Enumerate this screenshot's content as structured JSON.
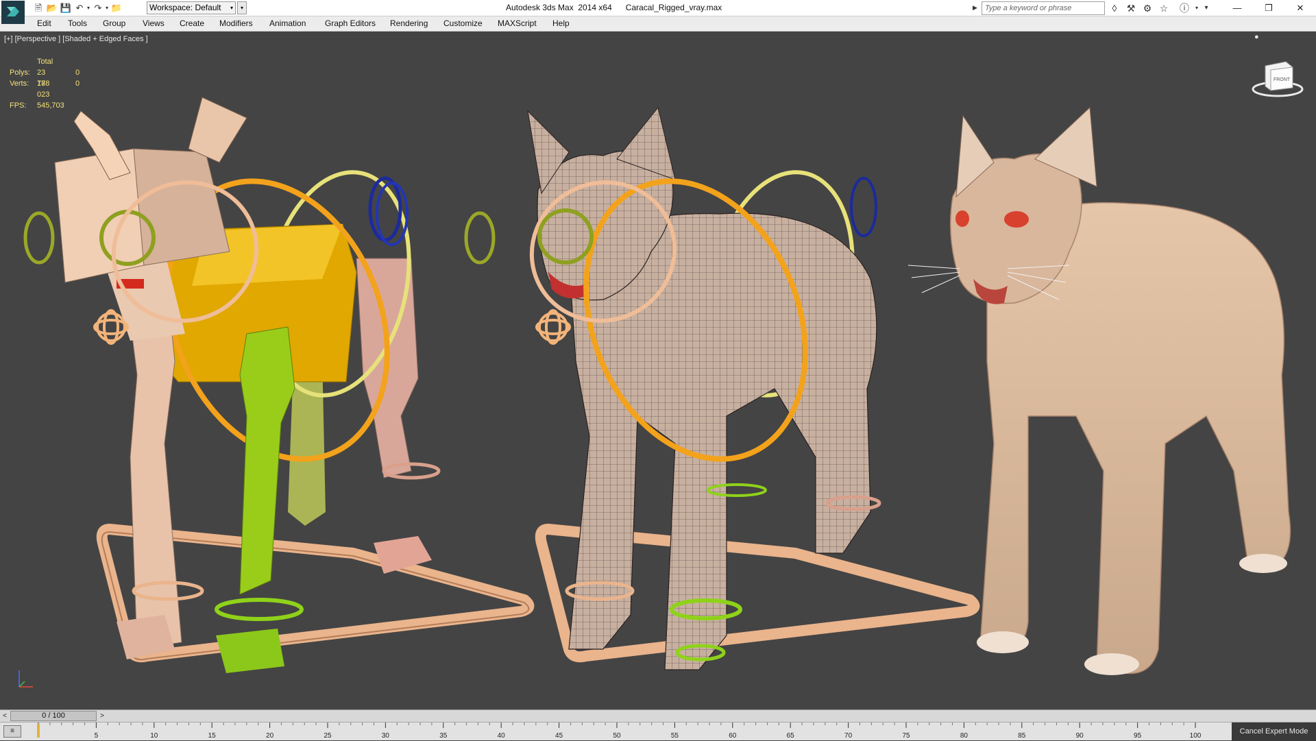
{
  "titlebar": {
    "workspace_label": "Workspace: Default",
    "app_title": "Autodesk 3ds Max  2014 x64",
    "file_name": "Caracal_Rigged_vray.max",
    "search_placeholder": "Type a keyword or phrase",
    "quick_access_icons": [
      "new-file-icon",
      "open-folder-icon",
      "save-icon",
      "undo-icon",
      "redo-icon",
      "project-folder-icon"
    ],
    "toolbar_icons": [
      "binoculars-icon",
      "tools-icon",
      "star-icon",
      "help-icon"
    ],
    "window_controls": [
      "minimize-icon",
      "restore-icon",
      "close-icon"
    ]
  },
  "menu": {
    "items": [
      "Edit",
      "Tools",
      "Group",
      "Views",
      "Create",
      "Modifiers",
      "Animation",
      "Graph Editors",
      "Rendering",
      "Customize",
      "MAXScript",
      "Help"
    ]
  },
  "viewport": {
    "label": "[+] [Perspective ] [Shaded + Edged Faces ]",
    "stats": {
      "header": "Total",
      "polys_label": "Polys:",
      "polys_value": "23 788",
      "polys_selected": "0",
      "verts_label": "Verts:",
      "verts_value": "17 023",
      "verts_selected": "0",
      "fps_label": "FPS:",
      "fps_value": "545,703"
    },
    "viewcube_label": "FRONT",
    "colors": {
      "background": "#444444",
      "rig_yellow": "#e0a800",
      "rig_green": "#9acd1a",
      "rig_olive": "#8fa020",
      "rig_blue": "#1c2a9c",
      "rig_orange": "#f3a21b",
      "rig_peach": "#f0c090",
      "fur": "#dcb598",
      "stats_text": "#f4e27a"
    }
  },
  "timeline": {
    "position": "0 / 100",
    "ticks": [
      "0",
      "5",
      "10",
      "15",
      "20",
      "25",
      "30",
      "35",
      "40",
      "45",
      "50",
      "55",
      "60",
      "65",
      "70",
      "75",
      "80",
      "85",
      "90",
      "95",
      "100"
    ]
  },
  "statusbar": {
    "expert_mode_button": "Cancel Expert Mode"
  }
}
